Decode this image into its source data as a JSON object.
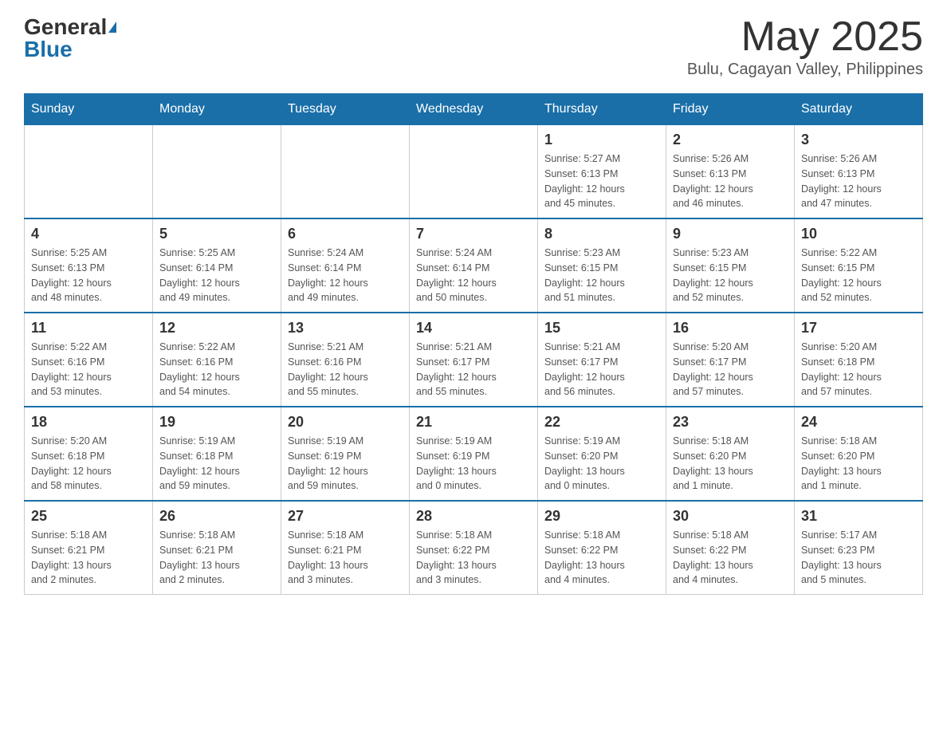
{
  "header": {
    "logo_general": "General",
    "logo_blue": "Blue",
    "month_title": "May 2025",
    "location": "Bulu, Cagayan Valley, Philippines"
  },
  "days_of_week": [
    "Sunday",
    "Monday",
    "Tuesday",
    "Wednesday",
    "Thursday",
    "Friday",
    "Saturday"
  ],
  "weeks": [
    [
      {
        "day": "",
        "info": ""
      },
      {
        "day": "",
        "info": ""
      },
      {
        "day": "",
        "info": ""
      },
      {
        "day": "",
        "info": ""
      },
      {
        "day": "1",
        "info": "Sunrise: 5:27 AM\nSunset: 6:13 PM\nDaylight: 12 hours\nand 45 minutes."
      },
      {
        "day": "2",
        "info": "Sunrise: 5:26 AM\nSunset: 6:13 PM\nDaylight: 12 hours\nand 46 minutes."
      },
      {
        "day": "3",
        "info": "Sunrise: 5:26 AM\nSunset: 6:13 PM\nDaylight: 12 hours\nand 47 minutes."
      }
    ],
    [
      {
        "day": "4",
        "info": "Sunrise: 5:25 AM\nSunset: 6:13 PM\nDaylight: 12 hours\nand 48 minutes."
      },
      {
        "day": "5",
        "info": "Sunrise: 5:25 AM\nSunset: 6:14 PM\nDaylight: 12 hours\nand 49 minutes."
      },
      {
        "day": "6",
        "info": "Sunrise: 5:24 AM\nSunset: 6:14 PM\nDaylight: 12 hours\nand 49 minutes."
      },
      {
        "day": "7",
        "info": "Sunrise: 5:24 AM\nSunset: 6:14 PM\nDaylight: 12 hours\nand 50 minutes."
      },
      {
        "day": "8",
        "info": "Sunrise: 5:23 AM\nSunset: 6:15 PM\nDaylight: 12 hours\nand 51 minutes."
      },
      {
        "day": "9",
        "info": "Sunrise: 5:23 AM\nSunset: 6:15 PM\nDaylight: 12 hours\nand 52 minutes."
      },
      {
        "day": "10",
        "info": "Sunrise: 5:22 AM\nSunset: 6:15 PM\nDaylight: 12 hours\nand 52 minutes."
      }
    ],
    [
      {
        "day": "11",
        "info": "Sunrise: 5:22 AM\nSunset: 6:16 PM\nDaylight: 12 hours\nand 53 minutes."
      },
      {
        "day": "12",
        "info": "Sunrise: 5:22 AM\nSunset: 6:16 PM\nDaylight: 12 hours\nand 54 minutes."
      },
      {
        "day": "13",
        "info": "Sunrise: 5:21 AM\nSunset: 6:16 PM\nDaylight: 12 hours\nand 55 minutes."
      },
      {
        "day": "14",
        "info": "Sunrise: 5:21 AM\nSunset: 6:17 PM\nDaylight: 12 hours\nand 55 minutes."
      },
      {
        "day": "15",
        "info": "Sunrise: 5:21 AM\nSunset: 6:17 PM\nDaylight: 12 hours\nand 56 minutes."
      },
      {
        "day": "16",
        "info": "Sunrise: 5:20 AM\nSunset: 6:17 PM\nDaylight: 12 hours\nand 57 minutes."
      },
      {
        "day": "17",
        "info": "Sunrise: 5:20 AM\nSunset: 6:18 PM\nDaylight: 12 hours\nand 57 minutes."
      }
    ],
    [
      {
        "day": "18",
        "info": "Sunrise: 5:20 AM\nSunset: 6:18 PM\nDaylight: 12 hours\nand 58 minutes."
      },
      {
        "day": "19",
        "info": "Sunrise: 5:19 AM\nSunset: 6:18 PM\nDaylight: 12 hours\nand 59 minutes."
      },
      {
        "day": "20",
        "info": "Sunrise: 5:19 AM\nSunset: 6:19 PM\nDaylight: 12 hours\nand 59 minutes."
      },
      {
        "day": "21",
        "info": "Sunrise: 5:19 AM\nSunset: 6:19 PM\nDaylight: 13 hours\nand 0 minutes."
      },
      {
        "day": "22",
        "info": "Sunrise: 5:19 AM\nSunset: 6:20 PM\nDaylight: 13 hours\nand 0 minutes."
      },
      {
        "day": "23",
        "info": "Sunrise: 5:18 AM\nSunset: 6:20 PM\nDaylight: 13 hours\nand 1 minute."
      },
      {
        "day": "24",
        "info": "Sunrise: 5:18 AM\nSunset: 6:20 PM\nDaylight: 13 hours\nand 1 minute."
      }
    ],
    [
      {
        "day": "25",
        "info": "Sunrise: 5:18 AM\nSunset: 6:21 PM\nDaylight: 13 hours\nand 2 minutes."
      },
      {
        "day": "26",
        "info": "Sunrise: 5:18 AM\nSunset: 6:21 PM\nDaylight: 13 hours\nand 2 minutes."
      },
      {
        "day": "27",
        "info": "Sunrise: 5:18 AM\nSunset: 6:21 PM\nDaylight: 13 hours\nand 3 minutes."
      },
      {
        "day": "28",
        "info": "Sunrise: 5:18 AM\nSunset: 6:22 PM\nDaylight: 13 hours\nand 3 minutes."
      },
      {
        "day": "29",
        "info": "Sunrise: 5:18 AM\nSunset: 6:22 PM\nDaylight: 13 hours\nand 4 minutes."
      },
      {
        "day": "30",
        "info": "Sunrise: 5:18 AM\nSunset: 6:22 PM\nDaylight: 13 hours\nand 4 minutes."
      },
      {
        "day": "31",
        "info": "Sunrise: 5:17 AM\nSunset: 6:23 PM\nDaylight: 13 hours\nand 5 minutes."
      }
    ]
  ]
}
